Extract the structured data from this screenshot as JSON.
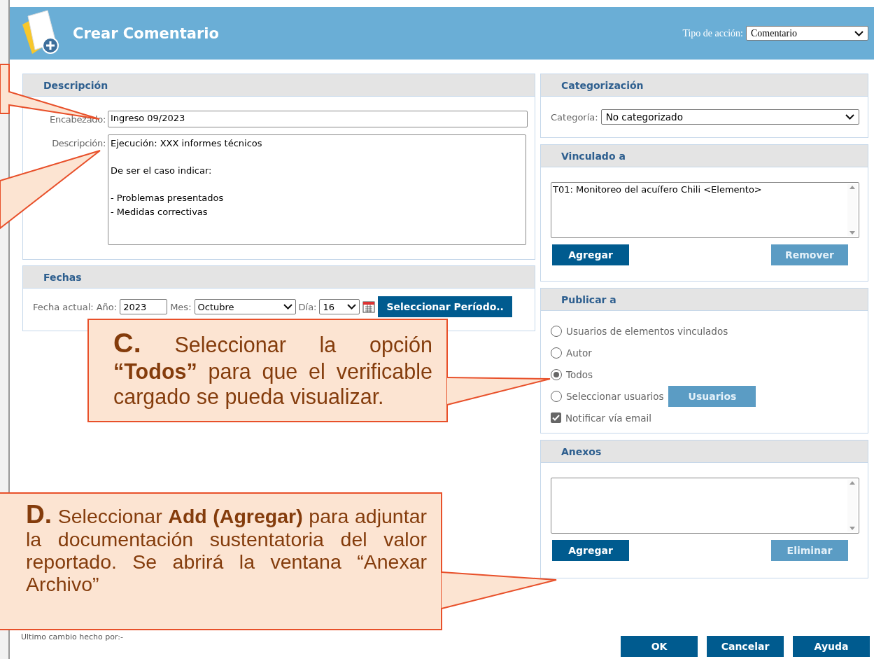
{
  "window": {
    "title": "Crear Comentario"
  },
  "action_type": {
    "label": "Tipo de acción:",
    "value": "Comentario"
  },
  "descripcion": {
    "title": "Descripción",
    "fields": [
      {
        "kind": "input",
        "label": "Encabezado:",
        "value": "Ingreso 09/2023"
      },
      {
        "kind": "textarea",
        "label": "Descripción:",
        "value": "Ejecución: XXX informes técnicos\n\nDe ser el caso indicar:\n\n- Problemas presentados\n- Medidas correctivas"
      }
    ]
  },
  "fechas": {
    "title": "Fechas",
    "label": "Fecha actual:",
    "year_label": "Año:",
    "year": "2023",
    "month_label": "Mes:",
    "month": "Octubre",
    "day_label": "Día:",
    "day": "16",
    "button": "Seleccionar Período.."
  },
  "categorizacion": {
    "title": "Categorización",
    "label": "Categoría:",
    "value": "No categorizado"
  },
  "vinculado": {
    "title": "Vinculado a",
    "items": [
      "T01: Monitoreo del acuífero Chili <Elemento>"
    ],
    "buttons": [
      {
        "label": "Agregar",
        "disabled": false
      },
      {
        "label": "Remover",
        "disabled": true
      }
    ]
  },
  "publicar": {
    "title": "Publicar a",
    "options": [
      {
        "label": "Usuarios de elementos vinculados",
        "selected": false
      },
      {
        "label": "Autor",
        "selected": false
      },
      {
        "label": "Todos",
        "selected": true
      },
      {
        "label": "Seleccionar usuarios",
        "selected": false,
        "button": {
          "label": "Usuarios",
          "disabled": true
        }
      }
    ],
    "notify": {
      "label": "Notificar vía email",
      "checked": true
    }
  },
  "anexos": {
    "title": "Anexos",
    "buttons": [
      {
        "label": "Agregar",
        "disabled": false
      },
      {
        "label": "Eliminar",
        "disabled": true
      }
    ]
  },
  "last_change": "Ultimo cambio hecho por:-",
  "buttons": [
    "OK",
    "Cancelar",
    "Ayuda"
  ],
  "callouts": [
    {
      "text": "**C.** Seleccionar la opción **“Todos”** para que el verificable cargado se pueda visualizar."
    },
    {
      "text": "**D.** Seleccionar **Add (Agregar)** para adjuntar la documentación sustentatoria del valor reportado. Se abrirá la ventana “Anexar Archivo”"
    }
  ]
}
